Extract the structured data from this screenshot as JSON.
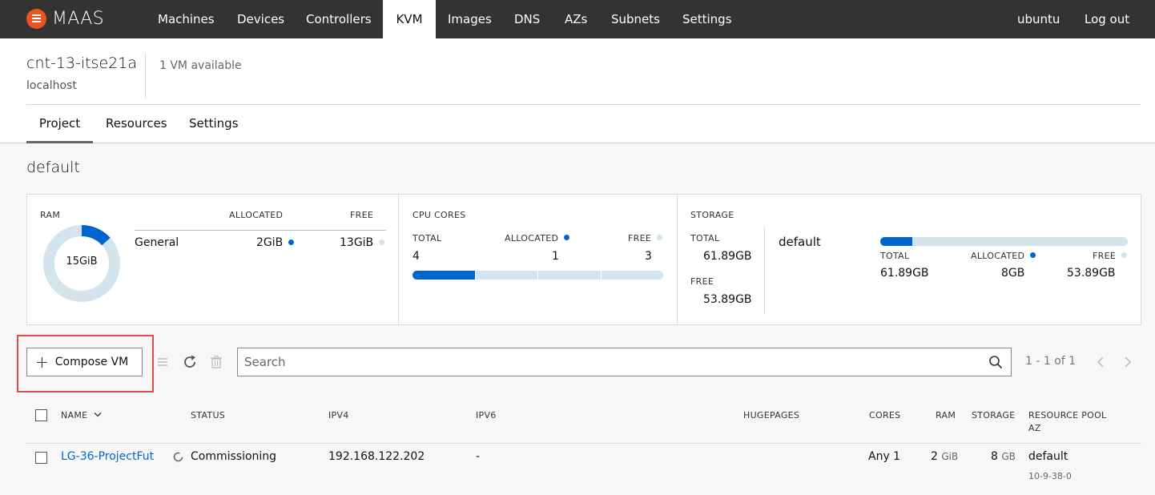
{
  "navbar": {
    "brand": "MAAS",
    "items": [
      {
        "label": "Machines",
        "active": false
      },
      {
        "label": "Devices",
        "active": false
      },
      {
        "label": "Controllers",
        "active": false
      },
      {
        "label": "KVM",
        "active": true
      },
      {
        "label": "Images",
        "active": false
      },
      {
        "label": "DNS",
        "active": false
      },
      {
        "label": "AZs",
        "active": false
      },
      {
        "label": "Subnets",
        "active": false
      },
      {
        "label": "Settings",
        "active": false
      }
    ],
    "user": "ubuntu",
    "logout": "Log out"
  },
  "header": {
    "pod_name": "cnt-13-itse21a",
    "host": "localhost",
    "vm_available": "1 VM available",
    "tabs": [
      {
        "label": "Project",
        "active": true
      },
      {
        "label": "Resources",
        "active": false
      },
      {
        "label": "Settings",
        "active": false
      }
    ]
  },
  "project": {
    "title": "default"
  },
  "resources": {
    "ram": {
      "caption": "RAM",
      "total": "15GiB",
      "allocated_fraction": 0.133,
      "col_allocated": "ALLOCATED",
      "col_free": "FREE",
      "row_label": "General",
      "allocated": "2GiB",
      "free": "13GiB"
    },
    "cpu": {
      "caption": "CPU CORES",
      "total_label": "TOTAL",
      "allocated_label": "ALLOCATED",
      "free_label": "FREE",
      "total": "4",
      "allocated": "1",
      "free": "3",
      "allocated_fraction": 0.25
    },
    "storage": {
      "caption": "STORAGE",
      "total_label": "TOTAL",
      "total": "61.89GB",
      "free_label": "FREE",
      "free": "53.89GB",
      "pool_name": "default",
      "pool_total_label": "TOTAL",
      "pool_allocated_label": "ALLOCATED",
      "pool_free_label": "FREE",
      "pool_total": "61.89GB",
      "pool_allocated": "8GB",
      "pool_free": "53.89GB",
      "allocated_fraction": 0.129
    }
  },
  "toolbar": {
    "compose_label": "Compose VM",
    "search_placeholder": "Search",
    "pagination": "1 - 1 of 1"
  },
  "table": {
    "headers": {
      "name": "NAME",
      "status": "STATUS",
      "ipv4": "IPV4",
      "ipv6": "IPV6",
      "hugepages": "HUGEPAGES",
      "cores": "CORES",
      "ram": "RAM",
      "storage": "STORAGE",
      "pool": "RESOURCE POOL",
      "az": "AZ"
    },
    "rows": [
      {
        "name": "LG-36-ProjectFut",
        "status": "Commissioning",
        "ipv4": "192.168.122.202",
        "ipv6": "-",
        "hugepages": "",
        "cores": "Any 1",
        "ram_value": "2",
        "ram_unit": "GiB",
        "storage_value": "8",
        "storage_unit": "GB",
        "pool": "default",
        "az": "10-9-38-0"
      }
    ]
  },
  "colors": {
    "accent": "#0066cc",
    "brand": "#e95420",
    "navbar": "#333333",
    "free_bar": "#d3e4ed",
    "highlight": "#e04b4b"
  }
}
